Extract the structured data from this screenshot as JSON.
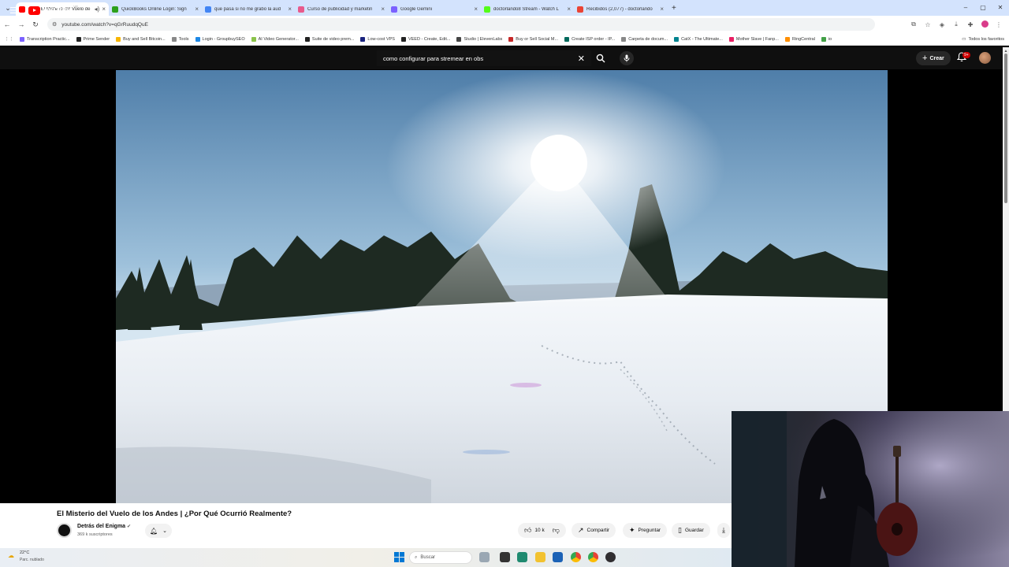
{
  "browser": {
    "tabs": [
      {
        "title": "(420) El Misterio del Vuelo de",
        "active": true,
        "color": "#ff0000"
      },
      {
        "title": "QuickBooks Online Login: Sign",
        "active": false,
        "color": "#2ca01c"
      },
      {
        "title": "que pasa si no me grabo la aud",
        "active": false,
        "color": "#4285f4"
      },
      {
        "title": "Curso de publicidad y marketin",
        "active": false,
        "color": "#e85a8c"
      },
      {
        "title": "Google Gemini",
        "active": false,
        "color": "#7b61ff"
      },
      {
        "title": "doctorlando8 Stream - Watch L",
        "active": false,
        "color": "#53fc18"
      },
      {
        "title": "Recibidos (2,077) - doctorlando",
        "active": false,
        "color": "#ea4335"
      }
    ],
    "url": "youtube.com/watch?v=qGrRuudqQuE",
    "bookmarks": [
      {
        "label": "Transcription Practic...",
        "color": "#7b61ff"
      },
      {
        "label": "Prime Sender",
        "color": "#222"
      },
      {
        "label": "Buy and Sell Bitcoin...",
        "color": "#f7b500"
      },
      {
        "label": "Tools",
        "color": "#888"
      },
      {
        "label": "Login - GroupbuySEO",
        "color": "#1e88e5"
      },
      {
        "label": "AI Video Generator...",
        "color": "#8bc34a"
      },
      {
        "label": "Suite de video prem...",
        "color": "#222"
      },
      {
        "label": "Low-cost VPS",
        "color": "#1a237e"
      },
      {
        "label": "VEED - Create, Edit...",
        "color": "#222"
      },
      {
        "label": "Studio | ElevenLabs",
        "color": "#444"
      },
      {
        "label": "Buy or Sell Social M...",
        "color": "#c62828"
      },
      {
        "label": "Create ISP order - IP...",
        "color": "#00695c"
      },
      {
        "label": "Carpeta de docum...",
        "color": "#888"
      },
      {
        "label": "CatX - The Ultimate...",
        "color": "#00838f"
      },
      {
        "label": "Mother Slave | Fanp...",
        "color": "#e91e63"
      },
      {
        "label": "RingCentral",
        "color": "#ff8f00"
      },
      {
        "label": "io",
        "color": "#43a047"
      }
    ],
    "bookmarks_all": "Todos los favoritos"
  },
  "youtube": {
    "logo_text": "YouTube",
    "logo_country": "VE",
    "search_value": "como configurar para stremear en obs",
    "create_label": "Crear",
    "notif_badge": "9+",
    "video": {
      "title": "El Misterio del Vuelo de los Andes | ¿Por Qué Ocurrió Realmente?",
      "channel": "Detrás del Enigma",
      "subscribers": "369 k suscriptores",
      "likes": "10 k",
      "share_label": "Compartir",
      "ask_label": "Preguntar",
      "save_label": "Guardar"
    }
  },
  "taskbar": {
    "temperature": "22°C",
    "weather": "Parc. nublado",
    "search_placeholder": "Buscar"
  },
  "colors": {
    "yt_red": "#ff0000",
    "yt_bg": "#0f0f0f",
    "chrome_tabstrip": "#d3e3fd"
  }
}
